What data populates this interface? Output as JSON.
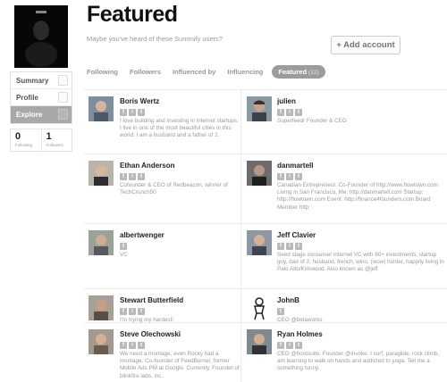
{
  "sidebar": {
    "items": [
      {
        "label": "Summary",
        "icon": "document-icon",
        "active": false
      },
      {
        "label": "Profile",
        "icon": "person-icon",
        "active": false
      },
      {
        "label": "Explore",
        "icon": "explore-icon",
        "active": true
      }
    ],
    "stats": [
      {
        "value": "0",
        "label": "Following"
      },
      {
        "value": "1",
        "label": "Followers"
      }
    ]
  },
  "header": {
    "title": "Featured",
    "subtitle": "Maybe you've heard of these Summify users?",
    "add_account_label": "+ Add account"
  },
  "tabs": [
    {
      "label": "Following",
      "active": false
    },
    {
      "label": "Followers",
      "active": false
    },
    {
      "label": "Influenced by",
      "active": false
    },
    {
      "label": "Influencing",
      "active": false
    },
    {
      "label": "Featured",
      "count": "(12)",
      "active": true
    }
  ],
  "users": [
    {
      "name": "Boris Wertz",
      "networks": [
        "f",
        "l",
        "t"
      ],
      "bio": "I love building and investing in internet startups. I live in one of the most beautiful cities in this world. I am a husband and a father of 2."
    },
    {
      "name": "julien",
      "networks": [
        "f",
        "l",
        "t"
      ],
      "bio": "Superfeedr Founder & CEO"
    },
    {
      "name": "Ethan Anderson",
      "networks": [
        "f",
        "l",
        "t"
      ],
      "bio": "Cofounder & CEO of Redbeacon, winner of TechCrunch50"
    },
    {
      "name": "danmartell",
      "networks": [
        "f",
        "l",
        "t"
      ],
      "bio": "Canadian Entrepreneur, Co-Founder of http://www.flowtown.com Living in San Francisco, Me: http://danmartell.com Startup: http://flowtown.com Event: http://finance4founders.com Board Member http:"
    },
    {
      "name": "albertwenger",
      "networks": [
        "t"
      ],
      "bio": "VC"
    },
    {
      "name": "Jeff Clavier",
      "networks": [
        "f",
        "l",
        "t"
      ],
      "bio": "Seed stage consumer internet VC with 80+ investments, startup guy, dad of 2, husband, french, wino, (wow) hunter, happily living in Palo Alto/Kirkwood. Also known as @jeff"
    },
    {
      "name": "Stewart Butterfield",
      "networks": [
        "f",
        "l",
        "t"
      ],
      "bio": "I'm trying my hardest!"
    },
    {
      "name": "JohnB",
      "networks": [
        "t"
      ],
      "bio": "CEO @betaworks"
    },
    {
      "name": "Steve Olechowski",
      "networks": [
        "f",
        "l",
        "t"
      ],
      "bio": "We need a montage, even Rocky had a montage. Co-founder of FeedBurner, former Mobile Ads PM at Google. Currently, Founder of blinkfire labs, inc."
    },
    {
      "name": "Ryan Holmes",
      "networks": [
        "f",
        "l",
        "t"
      ],
      "bio": "CEO @hootsuite, Founder @invoke. I surf, paraglide, rock climb, am learning to walk on hands and addicted to yoga. Tell me a something funny."
    }
  ],
  "colors": {
    "active_background": "#a8a8a8",
    "muted_text": "#999999",
    "title_text": "#111111"
  }
}
